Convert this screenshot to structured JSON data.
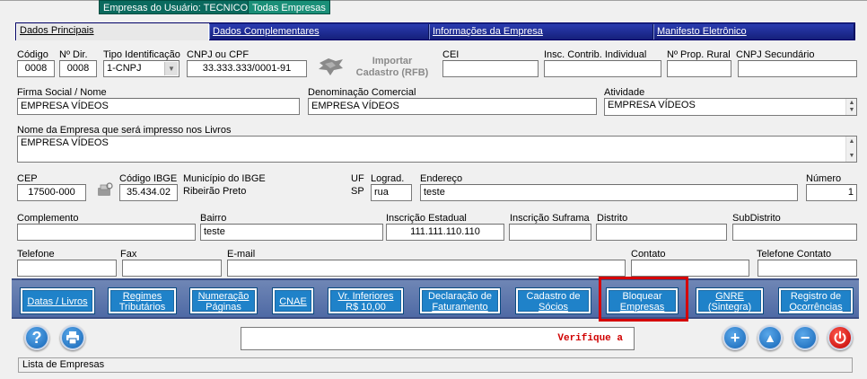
{
  "filter_tabs": {
    "user_companies": "Empresas do Usuário: TECNICO",
    "all_companies": "Todas Empresas"
  },
  "tabs": [
    "Dados Principais",
    "Dados Complementares",
    "Informações da Empresa",
    "Manifesto Eletrônico"
  ],
  "fields": {
    "codigo": {
      "label": "Código",
      "value": "0008"
    },
    "n_dir": {
      "label": "Nº Dir.",
      "value": "0008"
    },
    "tipo_ident": {
      "label": "Tipo Identificação",
      "value": "1-CNPJ"
    },
    "cnpj_cpf": {
      "label": "CNPJ ou CPF",
      "value": "33.333.333/0001-91"
    },
    "importar": {
      "line1": "Importar",
      "line2": "Cadastro (RFB)"
    },
    "cei": {
      "label": "CEI",
      "value": ""
    },
    "insc_contrib": {
      "label": "Insc. Contrib. Individual",
      "value": ""
    },
    "prop_rural": {
      "label": "Nº Prop. Rural",
      "value": ""
    },
    "cnpj_secundario": {
      "label": "CNPJ Secundário",
      "value": ""
    },
    "firma_social": {
      "label": "Firma Social / Nome",
      "value": "EMPRESA VÍDEOS"
    },
    "denominacao": {
      "label": "Denominação Comercial",
      "value": "EMPRESA VÍDEOS"
    },
    "atividade": {
      "label": "Atividade",
      "value": "EMPRESA VÍDEOS"
    },
    "nome_livros": {
      "label": "Nome da Empresa que será impresso nos Livros",
      "value": "EMPRESA VÍDEOS"
    },
    "cep": {
      "label": "CEP",
      "value": "17500-000"
    },
    "codigo_ibge": {
      "label": "Código IBGE",
      "value": "35.434.02"
    },
    "municipio_ibge": {
      "label": "Município do IBGE",
      "value": "Ribeirão Preto"
    },
    "uf": {
      "label": "UF",
      "value": "SP"
    },
    "lograd": {
      "label": "Lograd.",
      "value": "rua"
    },
    "endereco": {
      "label": "Endereço",
      "value": "teste"
    },
    "numero": {
      "label": "Número",
      "value": "1"
    },
    "complemento": {
      "label": "Complemento",
      "value": ""
    },
    "bairro": {
      "label": "Bairro",
      "value": "teste"
    },
    "insc_estadual": {
      "label": "Inscrição Estadual",
      "value": "111.111.110.110"
    },
    "insc_suframa": {
      "label": "Inscrição Suframa",
      "value": ""
    },
    "distrito": {
      "label": "Distrito",
      "value": ""
    },
    "subdistrito": {
      "label": "SubDistrito",
      "value": ""
    },
    "telefone": {
      "label": "Telefone",
      "value": ""
    },
    "fax": {
      "label": "Fax",
      "value": ""
    },
    "email": {
      "label": "E-mail",
      "value": ""
    },
    "contato": {
      "label": "Contato",
      "value": ""
    },
    "telefone_contato": {
      "label": "Telefone Contato",
      "value": ""
    }
  },
  "action_buttons": [
    {
      "line1": "Datas / Livros",
      "line2": ""
    },
    {
      "line1": "Regimes",
      "line2": "Tributários"
    },
    {
      "line1": "Numeração",
      "line2": "Páginas"
    },
    {
      "line1": "CNAE",
      "line2": ""
    },
    {
      "line1": "Vr. Inferiores",
      "line2": "R$ 10,00"
    },
    {
      "line1": "Declaração de",
      "line2": "Faturamento"
    },
    {
      "line1": "Cadastro de",
      "line2": "Sócios"
    },
    {
      "line1": "Bloquear",
      "line2": "Empresas"
    },
    {
      "line1": "GNRE",
      "line2": "(Sintegra)"
    },
    {
      "line1": "Registro de",
      "line2": "Ocorrências"
    }
  ],
  "message": "Verifique a",
  "status": "Lista de Empresas",
  "icons": {
    "help": "question-icon",
    "print": "printer-icon",
    "add": "plus-icon",
    "up": "arrow-up-icon",
    "remove": "minus-icon",
    "exit": "power-icon"
  },
  "colors": {
    "tab_bar": "#1f2e8c",
    "action_button": "#1f82c9",
    "highlight": "#d60000",
    "filter_tab": "#0a6a5e",
    "message_text": "#d00000"
  }
}
